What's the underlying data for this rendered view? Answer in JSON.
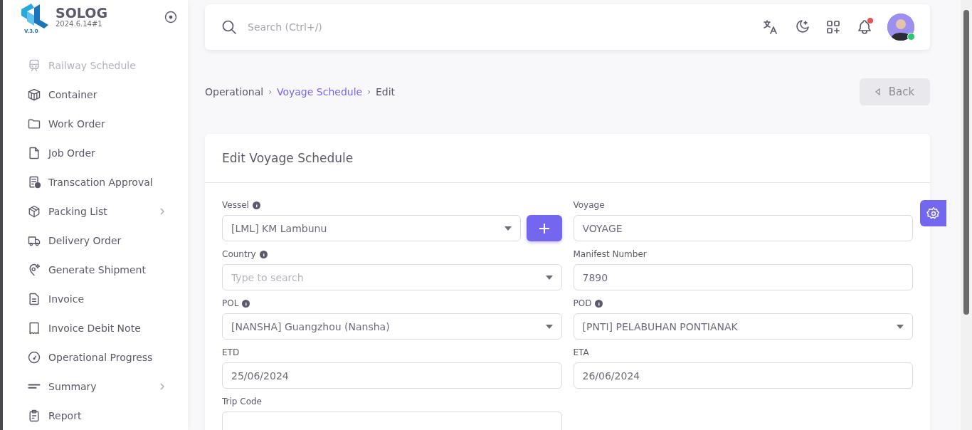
{
  "app": {
    "name": "SOLOG",
    "version": "2024.6.14#1",
    "logo_badge": "V.3.0"
  },
  "sidebar": {
    "items": [
      {
        "label": "Railway Schedule",
        "faded": true,
        "submenu": false
      },
      {
        "label": "Container",
        "faded": false,
        "submenu": false
      },
      {
        "label": "Work Order",
        "faded": false,
        "submenu": false
      },
      {
        "label": "Job Order",
        "faded": false,
        "submenu": false
      },
      {
        "label": "Transcation Approval",
        "faded": false,
        "submenu": false
      },
      {
        "label": "Packing List",
        "faded": false,
        "submenu": true
      },
      {
        "label": "Delivery Order",
        "faded": false,
        "submenu": false
      },
      {
        "label": "Generate Shipment",
        "faded": false,
        "submenu": false
      },
      {
        "label": "Invoice",
        "faded": false,
        "submenu": false
      },
      {
        "label": "Invoice Debit Note",
        "faded": false,
        "submenu": false
      },
      {
        "label": "Operational Progress",
        "faded": false,
        "submenu": false
      },
      {
        "label": "Summary",
        "faded": false,
        "submenu": true
      },
      {
        "label": "Report",
        "faded": false,
        "submenu": false
      }
    ]
  },
  "header": {
    "search": {
      "placeholder": "Search (Ctrl+/)"
    },
    "notification": true,
    "online": true
  },
  "breadcrumb": [
    {
      "label": "Operational",
      "kind": "text"
    },
    {
      "label": "›",
      "kind": "separator"
    },
    {
      "label": "Voyage Schedule",
      "kind": "link"
    },
    {
      "label": "›",
      "kind": "separator"
    },
    {
      "label": "Edit",
      "kind": "text"
    }
  ],
  "back_button": {
    "label": "Back",
    "disabled": true
  },
  "card": {
    "title": "Edit Voyage Schedule",
    "fields": [
      {
        "label": "Vessel",
        "info": true,
        "kind": "select",
        "value": "[LML] KM Lambunu",
        "add_button": true
      },
      {
        "label": "Voyage",
        "info": false,
        "kind": "text",
        "value": "VOYAGE"
      },
      {
        "label": "Country",
        "info": true,
        "kind": "select",
        "placeholder": "Type to search"
      },
      {
        "label": "Manifest Number",
        "info": false,
        "kind": "text",
        "value": "7890"
      },
      {
        "label": "POL",
        "info": true,
        "kind": "select",
        "value": "[NANSHA] Guangzhou (Nansha)"
      },
      {
        "label": "POD",
        "info": true,
        "kind": "select",
        "value": "[PNTI] PELABUHAN PONTIANAK"
      },
      {
        "label": "ETD",
        "info": false,
        "kind": "text",
        "value": "25/06/2024"
      },
      {
        "label": "ETA",
        "info": false,
        "kind": "text",
        "value": "26/06/2024"
      },
      {
        "label": "Trip Code",
        "info": false,
        "kind": "text"
      }
    ]
  }
}
